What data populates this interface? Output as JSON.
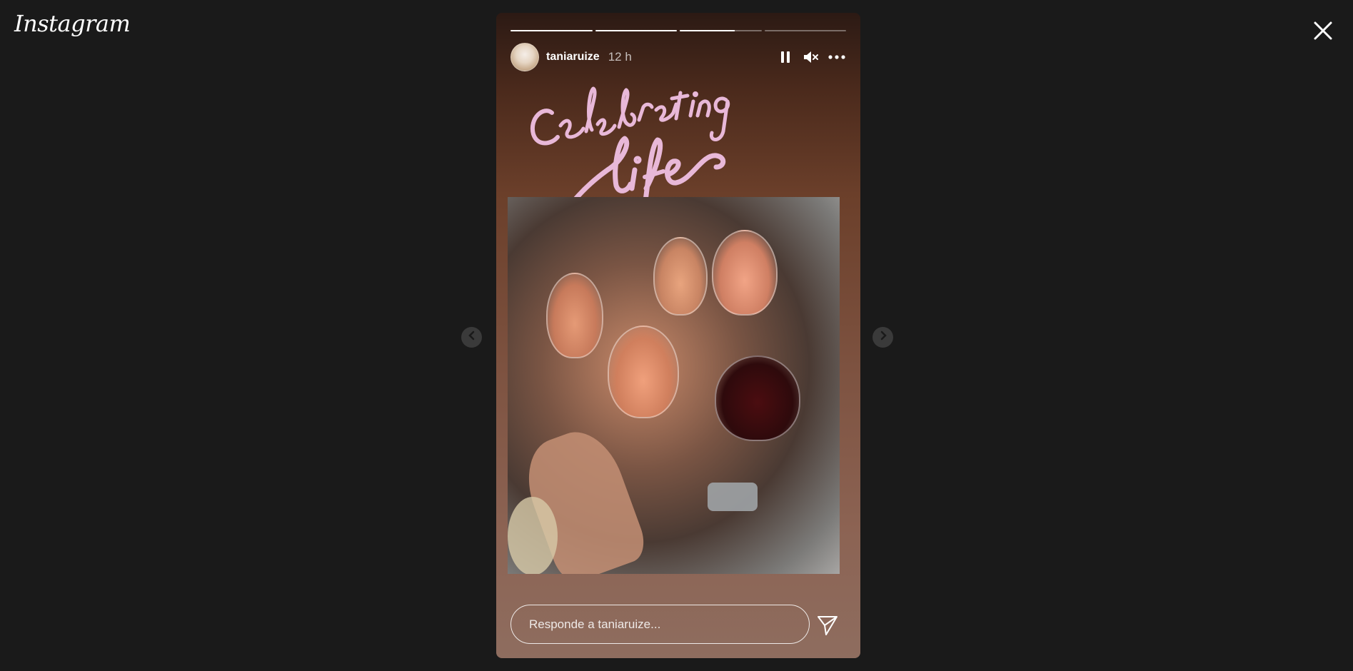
{
  "app": {
    "logo_text": "Instagram"
  },
  "story": {
    "username": "taniaruize",
    "time": "12 h",
    "progress": [
      1,
      1,
      0.67,
      0
    ],
    "sticker_text": "Celebrating life",
    "reply_placeholder": "Responde a taniaruize..."
  },
  "icons": {
    "close": "close-icon",
    "prev": "chevron-left-icon",
    "next": "chevron-right-icon",
    "pause": "pause-icon",
    "mute": "muted-speaker-icon",
    "more": "more-options-icon",
    "send": "send-icon"
  },
  "colors": {
    "background": "#1a1a1a",
    "sticker": "#e8b8d8"
  }
}
